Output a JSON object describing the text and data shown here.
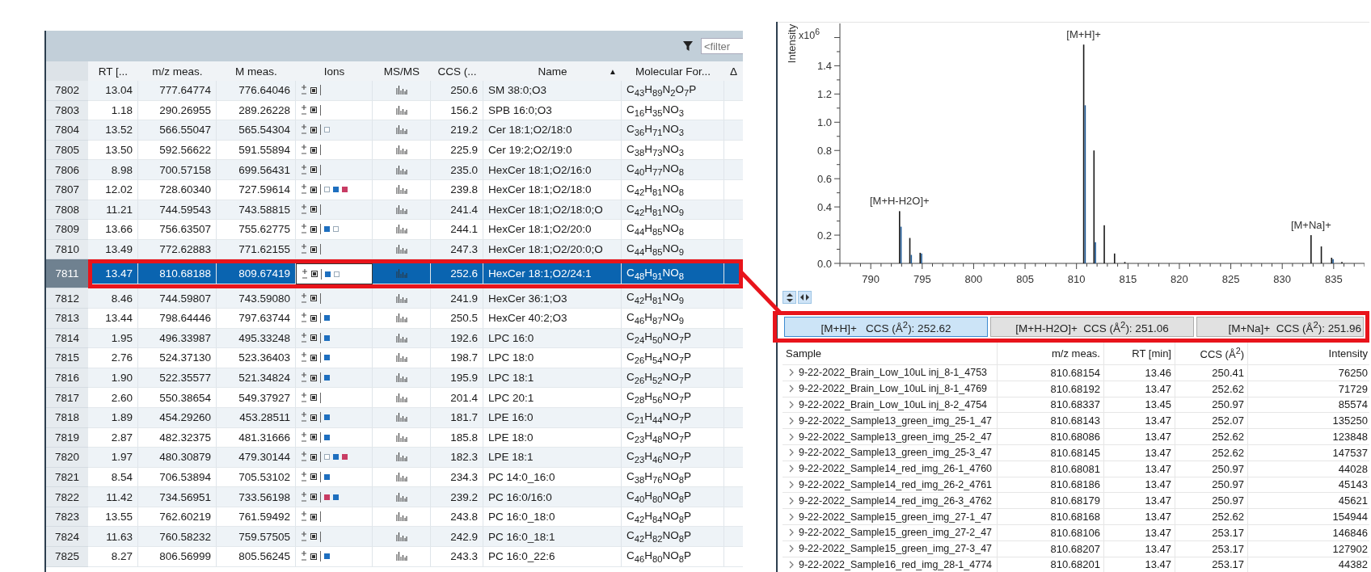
{
  "results": {
    "filter_placeholder": "<filter",
    "columns": [
      {
        "label": "RT [..."
      },
      {
        "label": "m/z meas."
      },
      {
        "label": "M meas."
      },
      {
        "label": "Ions"
      },
      {
        "label": "MS/MS"
      },
      {
        "label": "CCS (..."
      },
      {
        "label": "Name",
        "sort": "▲"
      },
      {
        "label": "Molecular For..."
      },
      {
        "label": "Δ"
      }
    ],
    "rows": [
      {
        "id": "7802",
        "rt": "13.04",
        "mz": "777.64774",
        "m": "776.64046",
        "adducts": [],
        "ccs": "250.6",
        "name": "SM 38:0;O3",
        "formula": "C$_{43}$H$_{89}$N$_{2}$O$_{7}$P",
        "selected": false
      },
      {
        "id": "7803",
        "rt": "1.18",
        "mz": "290.26955",
        "m": "289.26228",
        "adducts": [],
        "ccs": "156.2",
        "name": "SPB 16:0;O3",
        "formula": "C$_{16}$H$_{35}$NO$_{3}$",
        "selected": false
      },
      {
        "id": "7804",
        "rt": "13.52",
        "mz": "566.55047",
        "m": "565.54304",
        "adducts": [
          {
            "color": "#9aaab8",
            "filled": false
          }
        ],
        "ccs": "219.2",
        "name": "Cer 18:1;O2/18:0",
        "formula": "C$_{36}$H$_{71}$NO$_{3}$",
        "selected": false
      },
      {
        "id": "7805",
        "rt": "13.50",
        "mz": "592.56622",
        "m": "591.55894",
        "adducts": [],
        "ccs": "225.9",
        "name": "Cer 19:2;O2/19:0",
        "formula": "C$_{38}$H$_{73}$NO$_{3}$",
        "selected": false
      },
      {
        "id": "7806",
        "rt": "8.98",
        "mz": "700.57158",
        "m": "699.56431",
        "adducts": [],
        "ccs": "235.0",
        "name": "HexCer 18:1;O2/16:0",
        "formula": "C$_{40}$H$_{77}$NO$_{8}$",
        "selected": false
      },
      {
        "id": "7807",
        "rt": "12.02",
        "mz": "728.60340",
        "m": "727.59614",
        "adducts": [
          {
            "color": "#9aaab8",
            "filled": false
          },
          {
            "color": "#1e6fbf",
            "filled": true
          },
          {
            "color": "#c83c64",
            "filled": true
          }
        ],
        "ccs": "239.8",
        "name": "HexCer 18:1;O2/18:0",
        "formula": "C$_{42}$H$_{81}$NO$_{8}$",
        "selected": false
      },
      {
        "id": "7808",
        "rt": "11.21",
        "mz": "744.59543",
        "m": "743.58815",
        "adducts": [],
        "ccs": "241.4",
        "name": "HexCer 18:1;O2/18:0;O",
        "formula": "C$_{42}$H$_{81}$NO$_{9}$",
        "selected": false
      },
      {
        "id": "7809",
        "rt": "13.66",
        "mz": "756.63507",
        "m": "755.62775",
        "adducts": [
          {
            "color": "#1e6fbf",
            "filled": true
          },
          {
            "color": "#9aaab8",
            "filled": false
          }
        ],
        "ccs": "244.1",
        "name": "HexCer 18:1;O2/20:0",
        "formula": "C$_{44}$H$_{85}$NO$_{8}$",
        "selected": false
      },
      {
        "id": "7810",
        "rt": "13.49",
        "mz": "772.62883",
        "m": "771.62155",
        "adducts": [],
        "ccs": "247.3",
        "name": "HexCer 18:1;O2/20:0;O",
        "formula": "C$_{44}$H$_{85}$NO$_{9}$",
        "selected": false
      },
      {
        "id": "7811",
        "rt": "13.47",
        "mz": "810.68188",
        "m": "809.67419",
        "adducts": [
          {
            "color": "#1e6fbf",
            "filled": true
          },
          {
            "color": "#9aaab8",
            "filled": false
          }
        ],
        "ccs": "252.6",
        "name": "HexCer 18:1;O2/24:1",
        "formula": "C$_{48}$H$_{91}$NO$_{8}$",
        "selected": true
      },
      {
        "id": "7812",
        "rt": "8.46",
        "mz": "744.59807",
        "m": "743.59080",
        "adducts": [],
        "ccs": "241.9",
        "name": "HexCer 36:1;O3",
        "formula": "C$_{42}$H$_{81}$NO$_{9}$",
        "selected": false
      },
      {
        "id": "7813",
        "rt": "13.44",
        "mz": "798.64446",
        "m": "797.63744",
        "adducts": [
          {
            "color": "#1e6fbf",
            "filled": true
          }
        ],
        "ccs": "250.5",
        "name": "HexCer 40:2;O3",
        "formula": "C$_{46}$H$_{87}$NO$_{9}$",
        "selected": false
      },
      {
        "id": "7814",
        "rt": "1.95",
        "mz": "496.33987",
        "m": "495.33248",
        "adducts": [
          {
            "color": "#1e6fbf",
            "filled": true
          }
        ],
        "ccs": "192.6",
        "name": "LPC 16:0",
        "formula": "C$_{24}$H$_{50}$NO$_{7}$P",
        "selected": false
      },
      {
        "id": "7815",
        "rt": "2.76",
        "mz": "524.37130",
        "m": "523.36403",
        "adducts": [
          {
            "color": "#1e6fbf",
            "filled": true
          }
        ],
        "ccs": "198.7",
        "name": "LPC 18:0",
        "formula": "C$_{26}$H$_{54}$NO$_{7}$P",
        "selected": false
      },
      {
        "id": "7816",
        "rt": "1.90",
        "mz": "522.35577",
        "m": "521.34824",
        "adducts": [
          {
            "color": "#1e6fbf",
            "filled": true
          }
        ],
        "ccs": "195.9",
        "name": "LPC 18:1",
        "formula": "C$_{26}$H$_{52}$NO$_{7}$P",
        "selected": false
      },
      {
        "id": "7817",
        "rt": "2.60",
        "mz": "550.38654",
        "m": "549.37927",
        "adducts": [],
        "ccs": "201.4",
        "name": "LPC 20:1",
        "formula": "C$_{28}$H$_{56}$NO$_{7}$P",
        "selected": false
      },
      {
        "id": "7818",
        "rt": "1.89",
        "mz": "454.29260",
        "m": "453.28511",
        "adducts": [
          {
            "color": "#1e6fbf",
            "filled": true
          }
        ],
        "ccs": "181.7",
        "name": "LPE 16:0",
        "formula": "C$_{21}$H$_{44}$NO$_{7}$P",
        "selected": false
      },
      {
        "id": "7819",
        "rt": "2.87",
        "mz": "482.32375",
        "m": "481.31666",
        "adducts": [
          {
            "color": "#1e6fbf",
            "filled": true
          }
        ],
        "ccs": "185.8",
        "name": "LPE 18:0",
        "formula": "C$_{23}$H$_{48}$NO$_{7}$P",
        "selected": false
      },
      {
        "id": "7820",
        "rt": "1.97",
        "mz": "480.30879",
        "m": "479.30144",
        "adducts": [
          {
            "color": "#9aaab8",
            "filled": false
          },
          {
            "color": "#1e6fbf",
            "filled": true
          },
          {
            "color": "#c83c64",
            "filled": true
          }
        ],
        "ccs": "182.3",
        "name": "LPE 18:1",
        "formula": "C$_{23}$H$_{46}$NO$_{7}$P",
        "selected": false
      },
      {
        "id": "7821",
        "rt": "8.54",
        "mz": "706.53894",
        "m": "705.53102",
        "adducts": [
          {
            "color": "#1e6fbf",
            "filled": true
          }
        ],
        "ccs": "234.3",
        "name": "PC 14:0_16:0",
        "formula": "C$_{38}$H$_{76}$NO$_{8}$P",
        "selected": false
      },
      {
        "id": "7822",
        "rt": "11.42",
        "mz": "734.56951",
        "m": "733.56198",
        "adducts": [
          {
            "color": "#c83c64",
            "filled": true
          },
          {
            "color": "#1e6fbf",
            "filled": true
          }
        ],
        "ccs": "239.2",
        "name": "PC 16:0/16:0",
        "formula": "C$_{40}$H$_{80}$NO$_{8}$P",
        "selected": false
      },
      {
        "id": "7823",
        "rt": "13.55",
        "mz": "762.60219",
        "m": "761.59492",
        "adducts": [],
        "ccs": "243.8",
        "name": "PC 16:0_18:0",
        "formula": "C$_{42}$H$_{84}$NO$_{8}$P",
        "selected": false
      },
      {
        "id": "7824",
        "rt": "11.63",
        "mz": "760.58232",
        "m": "759.57505",
        "adducts": [],
        "ccs": "242.9",
        "name": "PC 16:0_18:1",
        "formula": "C$_{42}$H$_{82}$NO$_{8}$P",
        "selected": false
      },
      {
        "id": "7825",
        "rt": "8.27",
        "mz": "806.56999",
        "m": "805.56245",
        "adducts": [
          {
            "color": "#1e6fbf",
            "filled": true
          }
        ],
        "ccs": "243.3",
        "name": "PC 16:0_22:6",
        "formula": "C$_{46}$H$_{80}$NO$_{8}$P",
        "selected": false
      }
    ]
  },
  "spectrum": {
    "axis_multiplier": "x10$^{6}$",
    "chart_data": {
      "type": "bar",
      "ylabel": "Intensity",
      "x": [
        792.8,
        793.8,
        794.8,
        810.7,
        811.7,
        812.7,
        813.7,
        814.7,
        832.8,
        833.8,
        834.8,
        835.8
      ],
      "series": [
        {
          "color": "#1a1a1a",
          "values": [
            0.37,
            0.18,
            0.075,
            1.55,
            0.8,
            0.27,
            0.07,
            0.01,
            0.2,
            0.12,
            0.04,
            0.01
          ]
        },
        {
          "color": "#1f5a96",
          "values": [
            0.26,
            0.06,
            0.07,
            1.12,
            0.15,
            null,
            null,
            null,
            null,
            null,
            0.03,
            null
          ]
        }
      ],
      "xlim": [
        787,
        838
      ],
      "ylim": [
        0,
        1.7
      ],
      "xticks": [
        790,
        795,
        800,
        805,
        810,
        815,
        820,
        825,
        830,
        835
      ],
      "yticks": [
        {
          "value": 0,
          "label": "0.0"
        },
        {
          "value": 0.2,
          "label": "0.2"
        },
        {
          "value": 0.4,
          "label": "0.4"
        },
        {
          "value": 0.6,
          "label": "0.6"
        },
        {
          "value": 0.8,
          "label": "0.8"
        },
        {
          "value": 1.0,
          "label": "1.0"
        },
        {
          "value": 1.2,
          "label": "1.2"
        },
        {
          "value": 1.4,
          "label": "1.4"
        }
      ],
      "annotations": [
        {
          "x": 792.8,
          "y": 0.37,
          "text": "[M+H-H2O]+"
        },
        {
          "x": 810.7,
          "y": 1.55,
          "text": "[M+H]+"
        },
        {
          "x": 832.8,
          "y": 0.2,
          "text": "[M+Na]+"
        }
      ]
    }
  },
  "adduct_tabs": [
    {
      "label": "[M+H]+   CCS (Å$^{2}$): 252.62",
      "selected": true
    },
    {
      "label": "[M+H-H2O]+  CCS (Å$^{2}$): 251.06",
      "selected": false
    },
    {
      "label": "[M+Na]+  CCS (Å$^{2}$): 251.96",
      "selected": false
    }
  ],
  "samples": {
    "columns": [
      "Sample",
      "m/z meas.",
      "RT [min]",
      "CCS (Å$^{2}$)",
      "Intensity"
    ],
    "rows": [
      {
        "sample": "9-22-2022_Brain_Low_10uL inj_8-1_4753",
        "mz": "810.68154",
        "rt": "13.46",
        "ccs": "250.41",
        "intensity": "76250"
      },
      {
        "sample": "9-22-2022_Brain_Low_10uL inj_8-1_4769",
        "mz": "810.68192",
        "rt": "13.47",
        "ccs": "252.62",
        "intensity": "71729"
      },
      {
        "sample": "9-22-2022_Brain_Low_10uL inj_8-2_4754",
        "mz": "810.68337",
        "rt": "13.45",
        "ccs": "250.97",
        "intensity": "85574"
      },
      {
        "sample": "9-22-2022_Sample13_green_img_25-1_47",
        "mz": "810.68143",
        "rt": "13.47",
        "ccs": "252.07",
        "intensity": "135250"
      },
      {
        "sample": "9-22-2022_Sample13_green_img_25-2_47",
        "mz": "810.68086",
        "rt": "13.47",
        "ccs": "252.62",
        "intensity": "123848"
      },
      {
        "sample": "9-22-2022_Sample13_green_img_25-3_47",
        "mz": "810.68145",
        "rt": "13.47",
        "ccs": "252.62",
        "intensity": "147537"
      },
      {
        "sample": "9-22-2022_Sample14_red_img_26-1_4760",
        "mz": "810.68081",
        "rt": "13.47",
        "ccs": "250.97",
        "intensity": "44028"
      },
      {
        "sample": "9-22-2022_Sample14_red_img_26-2_4761",
        "mz": "810.68186",
        "rt": "13.47",
        "ccs": "250.97",
        "intensity": "45143"
      },
      {
        "sample": "9-22-2022_Sample14_red_img_26-3_4762",
        "mz": "810.68179",
        "rt": "13.47",
        "ccs": "250.97",
        "intensity": "45621"
      },
      {
        "sample": "9-22-2022_Sample15_green_img_27-1_47",
        "mz": "810.68168",
        "rt": "13.47",
        "ccs": "252.62",
        "intensity": "154944"
      },
      {
        "sample": "9-22-2022_Sample15_green_img_27-2_47",
        "mz": "810.68106",
        "rt": "13.47",
        "ccs": "253.17",
        "intensity": "146846"
      },
      {
        "sample": "9-22-2022_Sample15_green_img_27-3_47",
        "mz": "810.68207",
        "rt": "13.47",
        "ccs": "253.17",
        "intensity": "127902"
      },
      {
        "sample": "9-22-2022_Sample16_red_img_28-1_4774",
        "mz": "810.68201",
        "rt": "13.47",
        "ccs": "253.17",
        "intensity": "44382"
      }
    ]
  }
}
